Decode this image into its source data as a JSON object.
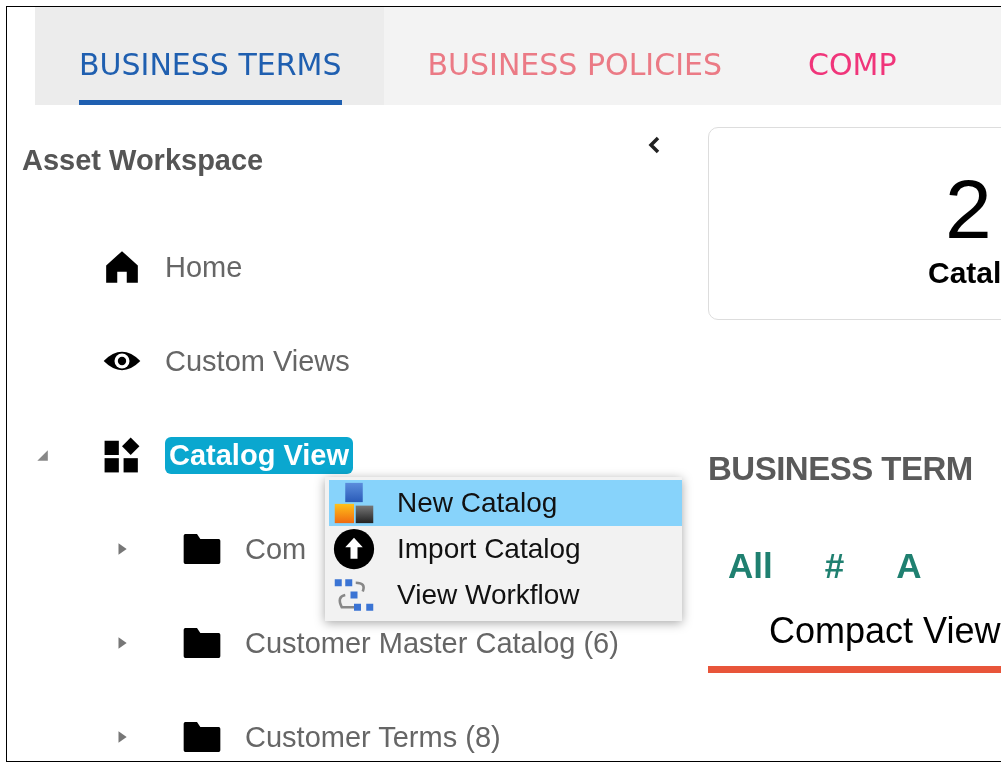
{
  "tabs": [
    {
      "label": "BUSINESS TERMS",
      "selected": true,
      "color": "#1f5fb0"
    },
    {
      "label": "BUSINESS POLICIES",
      "selected": false,
      "color": "#eb7a85"
    },
    {
      "label": "COMP",
      "selected": false,
      "color": "#f0357a"
    }
  ],
  "sidebar": {
    "title": "Asset Workspace",
    "items": [
      {
        "label": "Home",
        "selected": false
      },
      {
        "label": "Custom Views",
        "selected": false
      },
      {
        "label": "Catalog View",
        "selected": true,
        "expanded": true,
        "children": [
          {
            "label": "Com",
            "selected": false,
            "expanded": false
          },
          {
            "label": "Customer Master Catalog (6)",
            "selected": false,
            "expanded": false
          },
          {
            "label": "Customer Terms (8)",
            "selected": false,
            "expanded": false
          }
        ]
      }
    ]
  },
  "context_menu": {
    "items": [
      {
        "label": "New Catalog",
        "selected": true
      },
      {
        "label": "Import Catalog",
        "selected": false
      },
      {
        "label": "View Workflow",
        "selected": false
      }
    ]
  },
  "stat_card": {
    "value": "2",
    "label": "Catal"
  },
  "section_title": "BUSINESS TERM",
  "letter_filter": [
    "All",
    "#",
    "A"
  ],
  "view_tabs": [
    {
      "label": "Compact View",
      "selected": true
    }
  ]
}
